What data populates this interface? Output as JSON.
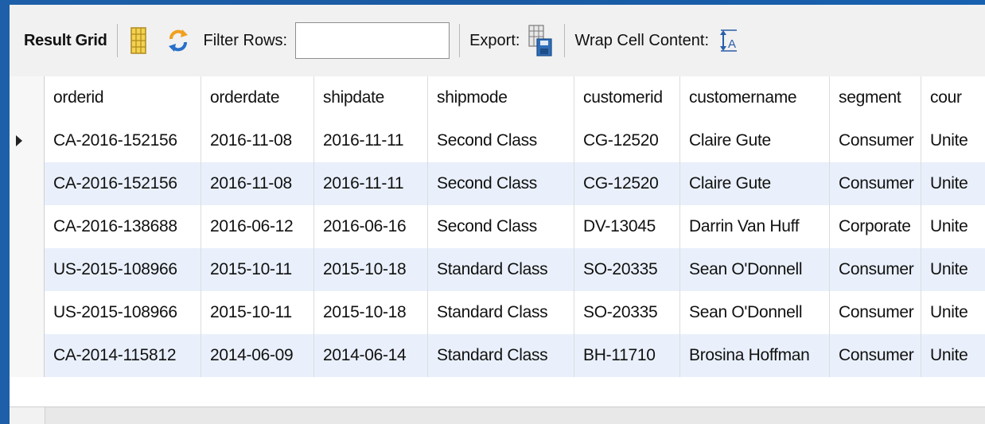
{
  "toolbar": {
    "result_grid_label": "Result Grid",
    "filter_rows_label": "Filter Rows:",
    "filter_value": "",
    "export_label": "Export:",
    "wrap_label": "Wrap Cell Content:"
  },
  "grid": {
    "columns": [
      "orderid",
      "orderdate",
      "shipdate",
      "shipmode",
      "customerid",
      "customername",
      "segment",
      "cour"
    ],
    "rows": [
      [
        "CA-2016-152156",
        "2016-11-08",
        "2016-11-11",
        "Second Class",
        "CG-12520",
        "Claire Gute",
        "Consumer",
        "Unite"
      ],
      [
        "CA-2016-152156",
        "2016-11-08",
        "2016-11-11",
        "Second Class",
        "CG-12520",
        "Claire Gute",
        "Consumer",
        "Unite"
      ],
      [
        "CA-2016-138688",
        "2016-06-12",
        "2016-06-16",
        "Second Class",
        "DV-13045",
        "Darrin Van Huff",
        "Corporate",
        "Unite"
      ],
      [
        "US-2015-108966",
        "2015-10-11",
        "2015-10-18",
        "Standard Class",
        "SO-20335",
        "Sean O'Donnell",
        "Consumer",
        "Unite"
      ],
      [
        "US-2015-108966",
        "2015-10-11",
        "2015-10-18",
        "Standard Class",
        "SO-20335",
        "Sean O'Donnell",
        "Consumer",
        "Unite"
      ],
      [
        "CA-2014-115812",
        "2014-06-09",
        "2014-06-14",
        "Standard Class",
        "BH-11710",
        "Brosina Hoffman",
        "Consumer",
        "Unite"
      ]
    ],
    "selected_row": 0
  },
  "colors": {
    "background": "#1a5aa3",
    "toolbar": "#f1f1f1",
    "alt_row": "#e9f0fb",
    "grid_line": "#dcdcdc"
  },
  "icons": [
    "grid-layout-icon",
    "refresh-icon",
    "export-icon",
    "wrap-cell-icon"
  ]
}
